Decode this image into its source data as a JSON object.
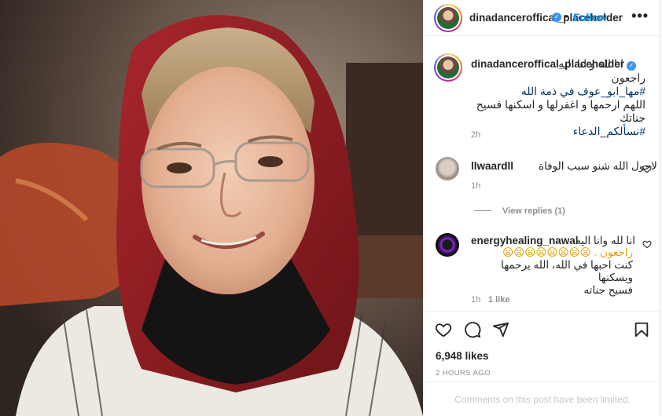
{
  "post": {
    "username": "dinadanceroffical_placeholder",
    "verified_mark": "✓",
    "dot": "•",
    "follow_label": "Follow",
    "more_label": "•••"
  },
  "caption": {
    "username": "dinadanceroffical_placeholder",
    "line1": "انا لله و انا اليه",
    "line2": "راجعون",
    "hashtag1": "#مها_ابو_عوف في ذمة الله",
    "line4": "اللهم ارحمها و اغفرلها و اسكنها فسيح جناتك",
    "hashtag2": "#نسألكم_الدعاء",
    "time": "2h"
  },
  "comments": [
    {
      "username": "llwaardll",
      "text": "لاحول الله شنو سبب الوفاة",
      "time": "1h",
      "view_replies": "View replies (1)"
    },
    {
      "username": "energyhealing_nawal",
      "text_line1": "انا لله وانا اليه",
      "text_line2": "راجعون . 😦😦😦😦😦😦😦😦",
      "text_line3": "كنت احبها في الله، الله يرحمها ويسكنها",
      "text_line4": "فسيح جناته",
      "time": "1h",
      "likes": "1 like"
    }
  ],
  "footer": {
    "likes": "6,948 likes",
    "ago": "2 HOURS AGO",
    "limited": "Comments on this post have been limited."
  },
  "icons": {
    "heart": "heart-icon",
    "comment": "comment-icon",
    "share": "share-icon",
    "save": "bookmark-icon"
  },
  "colors": {
    "accent": "#0095f6",
    "verified": "#3897f0",
    "muted": "#8e8e8e",
    "scarf": "#8b1e24"
  }
}
